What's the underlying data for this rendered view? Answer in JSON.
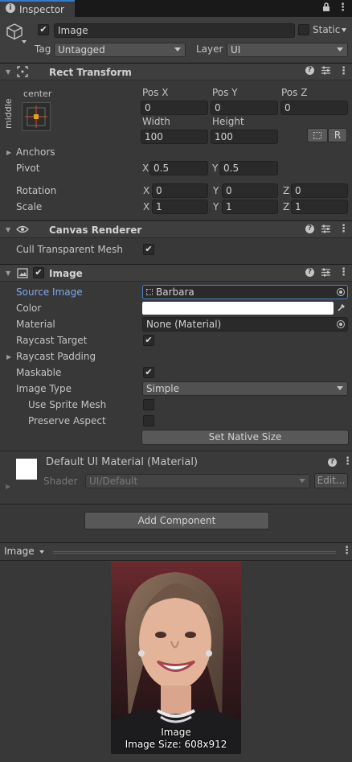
{
  "tab": {
    "title": "Inspector"
  },
  "object": {
    "name": "Image",
    "static_label": "Static",
    "tag_label": "Tag",
    "tag_value": "Untagged",
    "layer_label": "Layer",
    "layer_value": "UI"
  },
  "rect_transform": {
    "title": "Rect Transform",
    "anchor_preset_h": "center",
    "anchor_preset_v": "middle",
    "pos_x_label": "Pos X",
    "pos_x": "0",
    "pos_y_label": "Pos Y",
    "pos_y": "0",
    "pos_z_label": "Pos Z",
    "pos_z": "0",
    "width_label": "Width",
    "width": "100",
    "height_label": "Height",
    "height": "100",
    "raw_button": "R",
    "anchors_label": "Anchors",
    "pivot_label": "Pivot",
    "pivot_x": "0.5",
    "pivot_y": "0.5",
    "rotation_label": "Rotation",
    "rot_x": "0",
    "rot_y": "0",
    "rot_z": "0",
    "scale_label": "Scale",
    "scale_x": "1",
    "scale_y": "1",
    "scale_z": "1",
    "axis_x": "X",
    "axis_y": "Y",
    "axis_z": "Z"
  },
  "canvas_renderer": {
    "title": "Canvas Renderer",
    "cull_label": "Cull Transparent Mesh"
  },
  "image_component": {
    "title": "Image",
    "source_image_label": "Source Image",
    "source_image": "Barbara",
    "color_label": "Color",
    "color_value": "#ffffff",
    "material_label": "Material",
    "material": "None (Material)",
    "raycast_target_label": "Raycast Target",
    "raycast_padding_label": "Raycast Padding",
    "maskable_label": "Maskable",
    "image_type_label": "Image Type",
    "image_type": "Simple",
    "use_sprite_mesh_label": "Use Sprite Mesh",
    "preserve_aspect_label": "Preserve Aspect",
    "set_native_size": "Set Native Size"
  },
  "material_section": {
    "title": "Default UI Material (Material)",
    "shader_label": "Shader",
    "shader_value": "UI/Default",
    "edit_button": "Edit..."
  },
  "add_component": "Add Component",
  "preview": {
    "title": "Image",
    "caption_name": "Image",
    "caption_size": "Image Size: 608x912"
  },
  "colors": {
    "accent": "#3a79bb",
    "link_label": "#7da8e8",
    "panel": "#383838"
  }
}
